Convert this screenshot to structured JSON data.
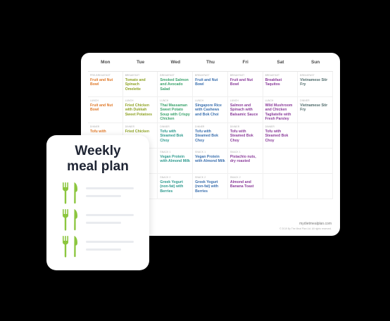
{
  "calendar": {
    "days": [
      "Mon",
      "Tue",
      "Wed",
      "Thu",
      "Fri",
      "Sat",
      "Sun"
    ],
    "rows": [
      [
        {
          "tag": "Pre-breakfast",
          "text": "Fruit and Nut Bowl",
          "color": "#e07a2a"
        },
        {
          "tag": "Breakfast",
          "text": "Tomato and Spinach Omelette",
          "color": "#8fa326"
        },
        {
          "tag": "Breakfast",
          "text": "Smoked Salmon and Avocado Salad",
          "color": "#3aa36c"
        },
        {
          "tag": "Breakfast",
          "text": "Fruit and Nut Bowl",
          "color": "#3a6fae"
        },
        {
          "tag": "Breakfast",
          "text": "Fruit and Nut Bowl",
          "color": "#8b3d9b"
        },
        {
          "tag": "Breakfast",
          "text": "Breakfast Taquitos",
          "color": "#8b3d9b"
        },
        {
          "tag": "Breakfast",
          "text": "Vietnamese Stir Fry",
          "color": "#4f6b6b"
        }
      ],
      [
        {
          "tag": "Lunch",
          "text": "Fruit and Nut Bowl",
          "color": "#e07a2a"
        },
        {
          "tag": "Lunch",
          "text": "Fried Chicken with Dukkah Sweet Potatoes",
          "color": "#8fa326"
        },
        {
          "tag": "Lunch",
          "text": "Thai Massaman Sweet Potato Soup with Crispy Chicken",
          "color": "#3aa36c"
        },
        {
          "tag": "Lunch",
          "text": "Singapore Rice with Cashews and Bok Choi",
          "color": "#3a6fae"
        },
        {
          "tag": "Lunch",
          "text": "Salmon and Spinach with Balsamic Sauce",
          "color": "#8b3d9b"
        },
        {
          "tag": "Lunch",
          "text": "Wild Mushroom and Chicken Tagliatelle with Fresh Parsley",
          "color": "#8b3d9b"
        },
        {
          "tag": "Dinner",
          "text": "Vietnamese Stir Fry",
          "color": "#4f6b6b"
        }
      ],
      [
        {
          "tag": "Dinner",
          "text": "Tofu with",
          "color": "#e07a2a"
        },
        {
          "tag": "Dinner",
          "text": "Fried Chicken",
          "color": "#8fa326"
        },
        {
          "tag": "Dinner",
          "text": "Tofu with Steamed Bok Choy",
          "color": "#2d9a8e"
        },
        {
          "tag": "Dinner",
          "text": "Tofu with Steamed Bok Choy",
          "color": "#3a6fae"
        },
        {
          "tag": "Dinner",
          "text": "Tofu with Steamed Bok Choy",
          "color": "#8b3d9b"
        },
        {
          "tag": "Dinner",
          "text": "Tofu with Steamed Bok Choy",
          "color": "#8b3d9b"
        },
        {
          "tag": "",
          "text": "",
          "color": "#4f6b6b"
        }
      ],
      [
        {
          "tag": "",
          "text": "",
          "color": "#e07a2a"
        },
        {
          "tag": "",
          "text": "",
          "color": "#8fa326"
        },
        {
          "tag": "Snack 1",
          "text": "Vegan Protein with Almond Milk",
          "color": "#2d9a8e"
        },
        {
          "tag": "Snack 1",
          "text": "Vegan Protein with Almond Milk",
          "color": "#3a6fae"
        },
        {
          "tag": "Snack 1",
          "text": "Pistachio nuts, dry roasted",
          "color": "#8b3d9b"
        },
        {
          "tag": "",
          "text": "",
          "color": "#8b3d9b"
        },
        {
          "tag": "",
          "text": "",
          "color": "#4f6b6b"
        }
      ],
      [
        {
          "tag": "",
          "text": "",
          "color": "#e07a2a"
        },
        {
          "tag": "",
          "text": "",
          "color": "#8fa326"
        },
        {
          "tag": "Snack 2",
          "text": "Greek Yogurt (non-fat) with Berries",
          "color": "#2d9a8e"
        },
        {
          "tag": "Snack 2",
          "text": "Greek Yogurt (non-fat) with Berries",
          "color": "#3a6fae"
        },
        {
          "tag": "Snack 2",
          "text": "Almond and Banana Toast",
          "color": "#8b3d9b"
        },
        {
          "tag": "",
          "text": "",
          "color": "#8b3d9b"
        },
        {
          "tag": "",
          "text": "",
          "color": "#4f6b6b"
        }
      ]
    ],
    "site": "mydietmealplan.com",
    "copyright": "© 2019 By The Meal Plan Ltd. All rights reserved."
  },
  "plan_card": {
    "title_line1": "Weekly",
    "title_line2": "meal plan",
    "icon": "fork-knife-icon",
    "icon_color": "#8cc63f",
    "rows": 3
  }
}
